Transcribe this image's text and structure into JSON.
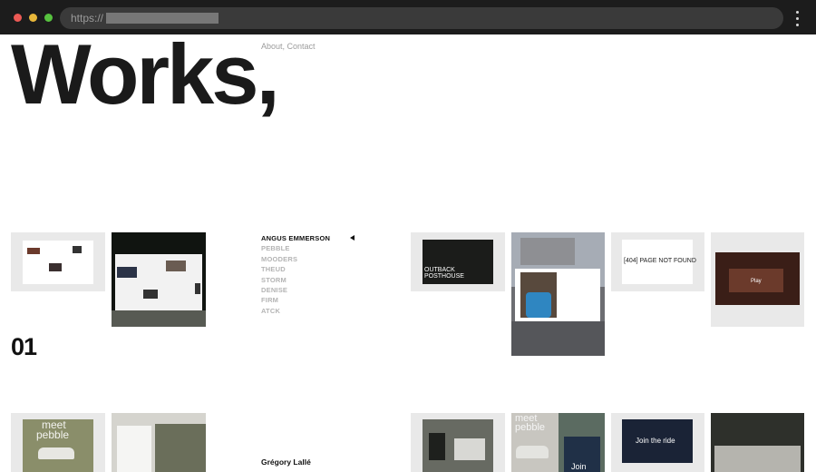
{
  "browser": {
    "url_prefix": "https://"
  },
  "page": {
    "title": "Works,",
    "top_links": "About, Contact",
    "index_number": "01",
    "author": "Grégory Lallé"
  },
  "projects": [
    {
      "label": "ANGUS EMMERSON",
      "active": true
    },
    {
      "label": "PEBBLE"
    },
    {
      "label": "MOODERS"
    },
    {
      "label": "THEUD"
    },
    {
      "label": "STORM"
    },
    {
      "label": "DENISE"
    },
    {
      "label": "FIRM"
    },
    {
      "label": "ATCK"
    }
  ],
  "thumb_texts": {
    "outback_line1": "OUTBACK",
    "outback_line2": "POSTHOUSE",
    "page404": "[404] PAGE NOT FOUND",
    "meet1": "meet",
    "meet2": "pebble",
    "join": "Join the ride",
    "join_short": "Join",
    "meet_b1": "meet",
    "meet_b2": "pebble",
    "play": "Play"
  },
  "colors": {
    "accent_text": "#111111",
    "muted_text": "#b4b4b4"
  }
}
